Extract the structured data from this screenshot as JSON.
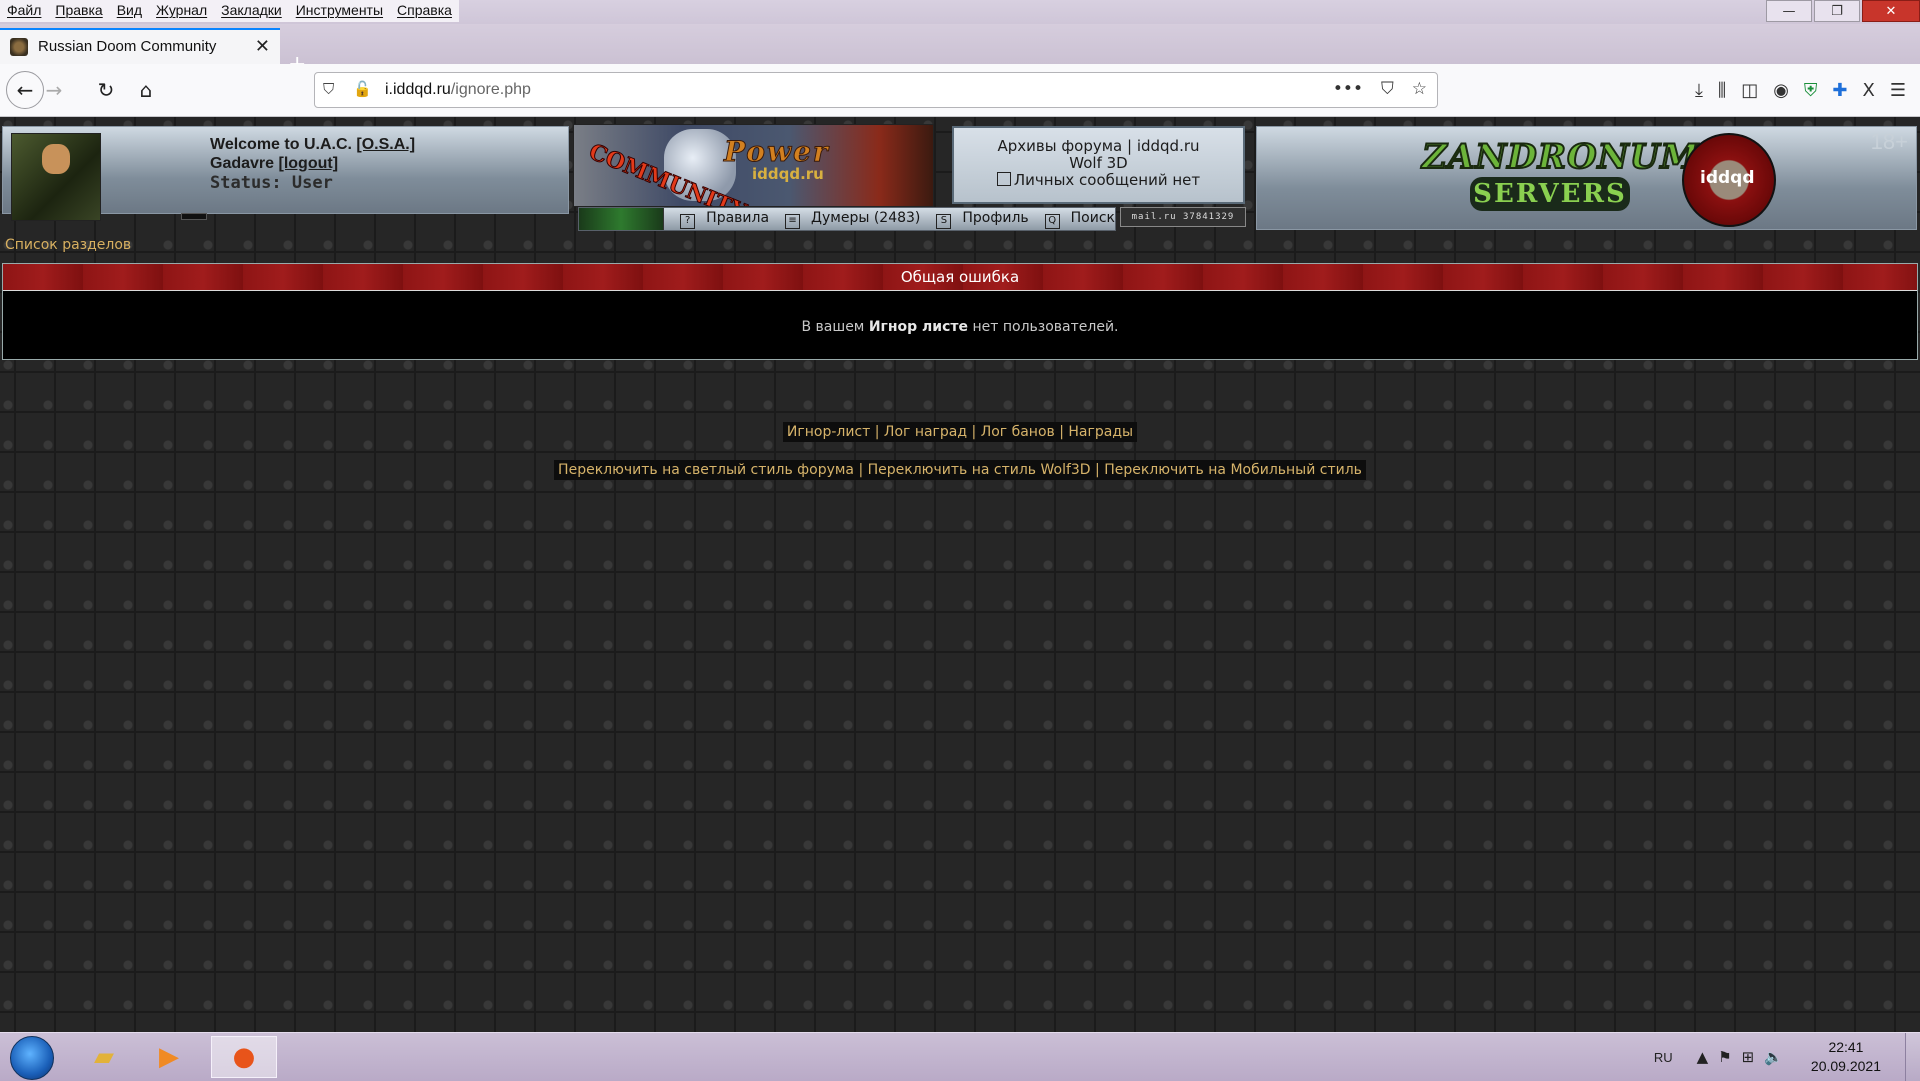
{
  "browser": {
    "menu": [
      "Файл",
      "Правка",
      "Вид",
      "Журнал",
      "Закладки",
      "Инструменты",
      "Справка"
    ],
    "window_buttons": {
      "minimize": "—",
      "maximize": "❐",
      "close": "✕"
    },
    "tab": {
      "title": "Russian Doom Community",
      "close": "✕"
    },
    "new_tab": "+",
    "nav": {
      "back": "←",
      "forward": "→",
      "reload": "↻",
      "home": "⌂"
    },
    "url": {
      "host": "i.iddqd.ru",
      "path": "/ignore.php"
    },
    "url_actions": {
      "more": "•••",
      "pocket": "⛉",
      "bookmark": "☆"
    },
    "toolbar_icons": {
      "download": "⤓",
      "library": "⫼",
      "sidebar": "◫",
      "account": "◉",
      "ext_shield": "⛨",
      "ext_puzzle": "✚",
      "ext_x": "X",
      "menu": "☰"
    }
  },
  "forum": {
    "user": {
      "welcome": "Welcome to U.A.C.",
      "unit": "[O.S.A.]",
      "name": "Gadavre",
      "logout": "[logout]",
      "status": "Status: User"
    },
    "logo": {
      "word": "Power",
      "site": "iddqd.ru",
      "community": "COMMUNITY"
    },
    "archive": {
      "line1": "Архивы форума | iddqd.ru",
      "line2": "Wolf 3D",
      "messages": "Личных сообщений нет"
    },
    "nav": [
      {
        "icon": "?",
        "label": "Правила"
      },
      {
        "icon": "≡",
        "label": "Думеры (2483)"
      },
      {
        "icon": "S",
        "label": "Профиль"
      },
      {
        "icon": "Q",
        "label": "Поиск"
      }
    ],
    "counter": "mail.ru 37841329",
    "banner": {
      "line1": "ZANDRONUM",
      "line2": "SERVERS",
      "badge": "iddqd"
    },
    "age": "18+",
    "breadcrumb": "Список разделов",
    "error": {
      "title": "Общая ошибка",
      "msg_pre": "В вашем ",
      "msg_bold": "Игнор листе",
      "msg_post": " нет пользователей."
    },
    "footer_links": [
      "Игнор-лист",
      "Лог наград",
      "Лог банов",
      "Награды"
    ],
    "style_links": [
      "Переключить на светлый стиль форума",
      "Переключить на стиль Wolf3D",
      "Переключить на Мобильный стиль"
    ]
  },
  "taskbar": {
    "lang": "RU",
    "tray_icons": {
      "arrow": "▲",
      "flag": "⚑",
      "network": "⊞",
      "volume": "🔈"
    },
    "time": "22:41",
    "date": "20.09.2021"
  }
}
